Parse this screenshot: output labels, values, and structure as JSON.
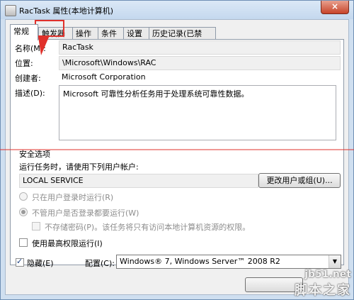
{
  "window": {
    "title": "RacTask 属性(本地计算机)",
    "close": "×"
  },
  "tabs": [
    "常规",
    "触发器",
    "操作",
    "条件",
    "设置",
    "历史记录(已禁用)"
  ],
  "general": {
    "name_label": "名称(M):",
    "name_value": "RacTask",
    "location_label": "位置:",
    "location_value": "\\Microsoft\\Windows\\RAC",
    "author_label": "创建者:",
    "author_value": "Microsoft Corporation",
    "desc_label": "描述(D):",
    "desc_value": "Microsoft 可靠性分析任务用于处理系统可靠性数据。"
  },
  "security": {
    "section_label": "安全选项",
    "run_as_label": "运行任务时，请使用下列用户帐户:",
    "run_as_value": "LOCAL SERVICE",
    "change_user_button": "更改用户或组(U)...",
    "radio_logged_on": "只在用户登录时运行(R)",
    "radio_any": "不管用户是否登录都要运行(W)",
    "no_store_password": "不存储密码(P)。该任务将只有访问本地计算机资源的权限。",
    "highest_privileges": "使用最高权限运行(I)"
  },
  "footer": {
    "hidden_label": "隐藏(E)",
    "config_label": "配置(C):",
    "config_value": "Windows® 7, Windows Server™ 2008 R2"
  },
  "watermark": {
    "line1": "jb51.net",
    "line2": "脚本之家"
  },
  "colors": {
    "annotation_red": "#e0312b",
    "title_bg": "#cfdff0"
  }
}
